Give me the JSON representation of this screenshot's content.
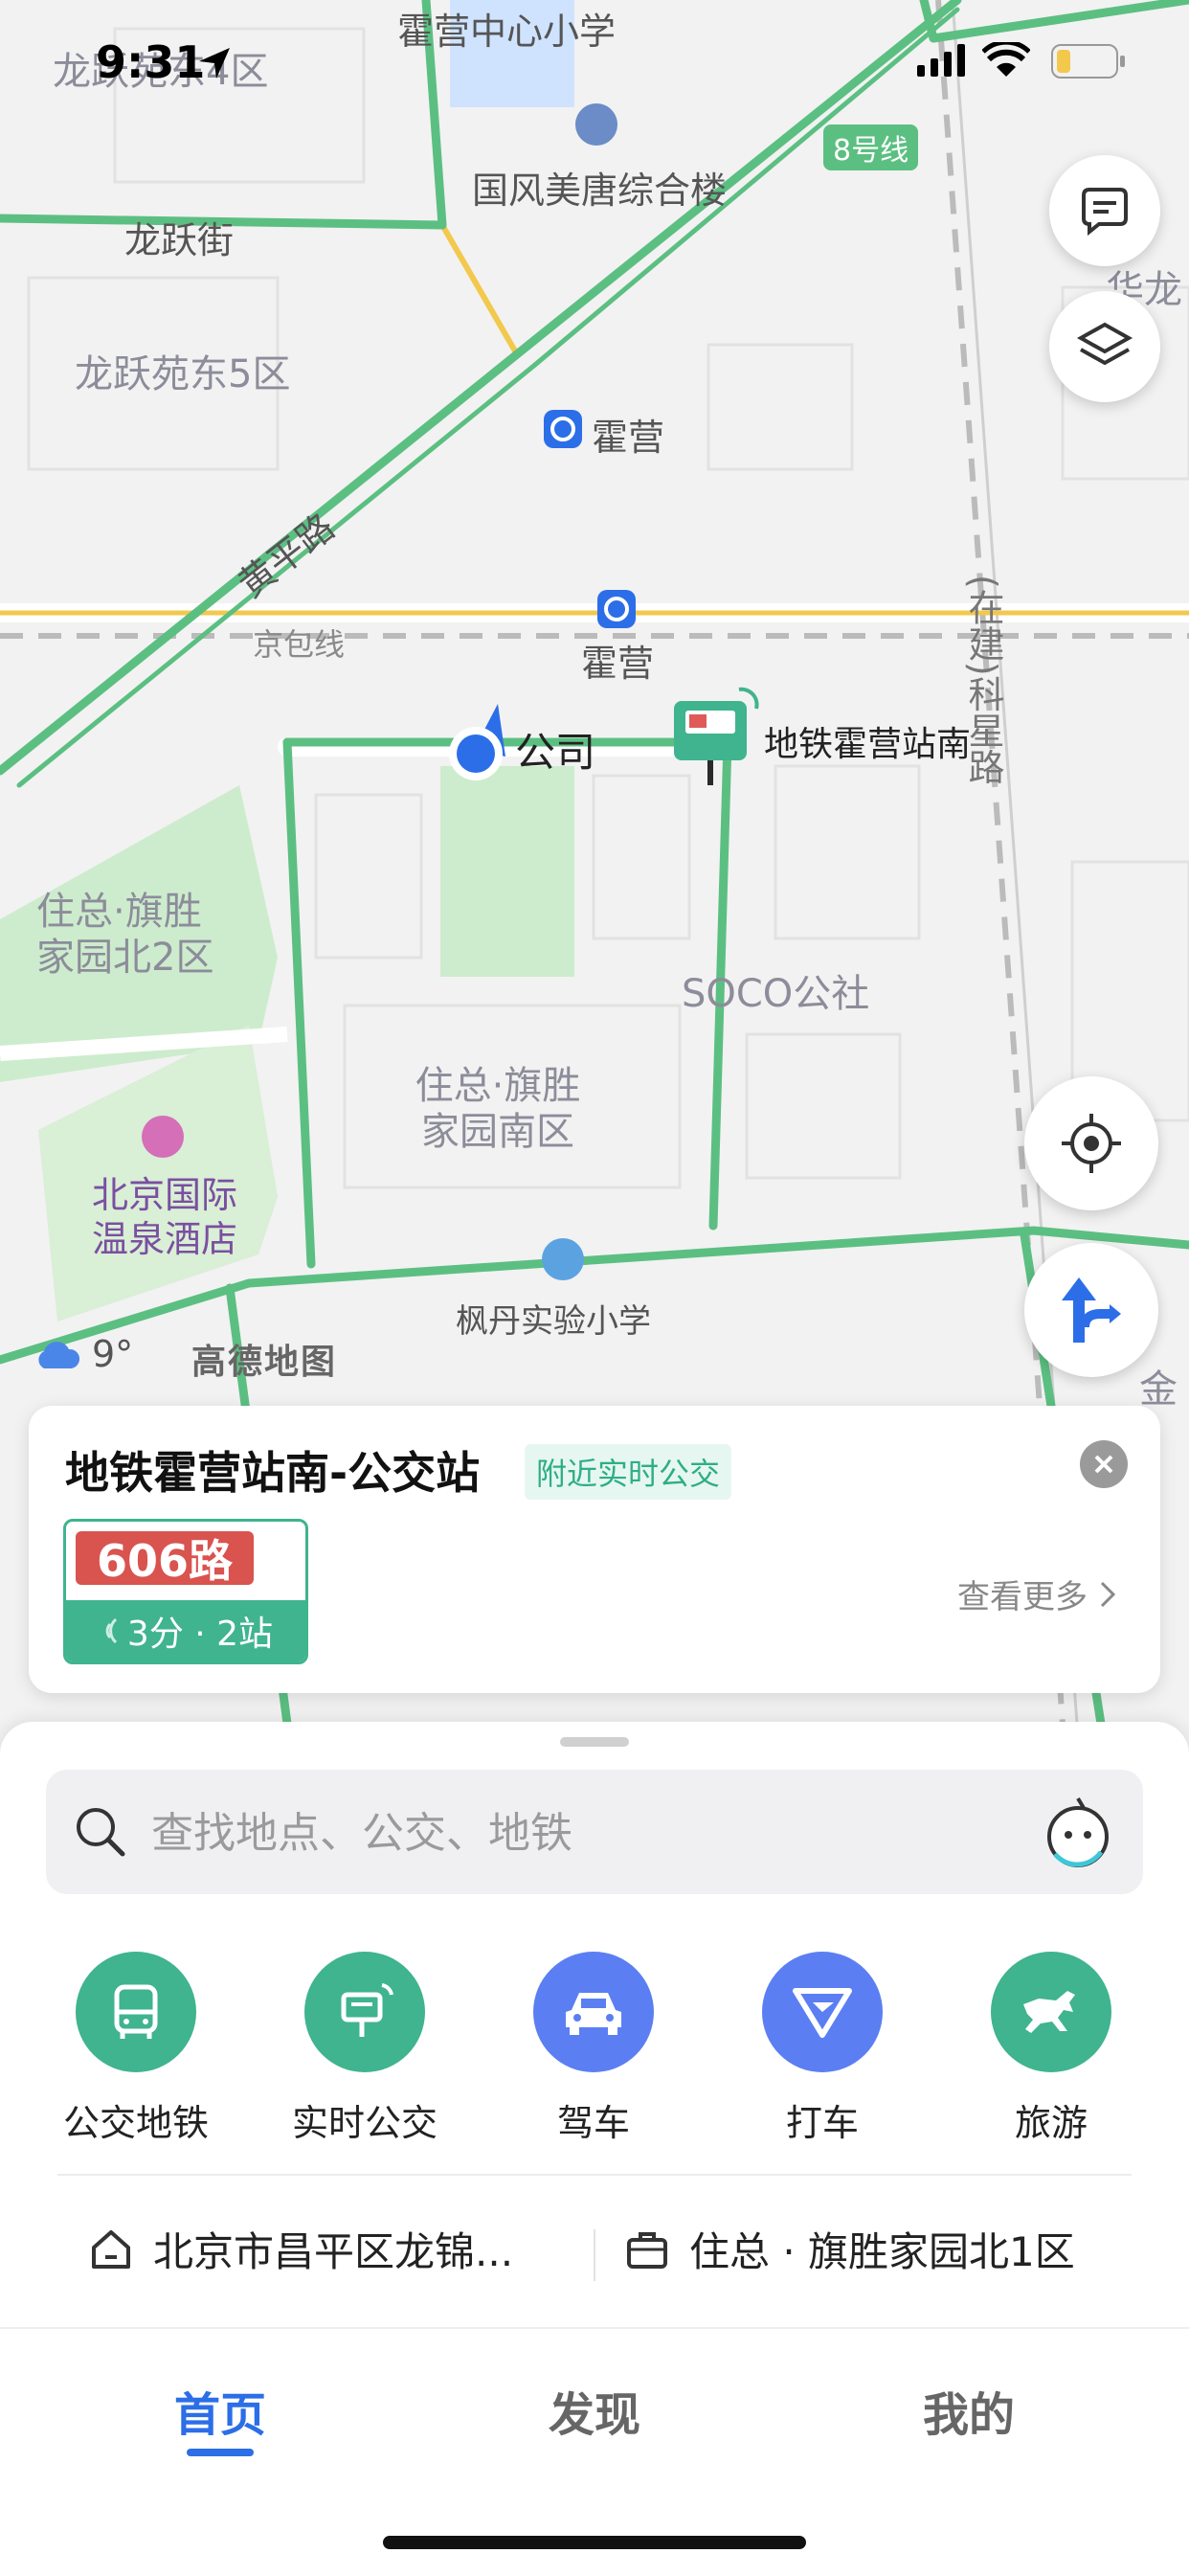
{
  "status_bar": {
    "time": "9:31",
    "battery_color": "#f2c94c"
  },
  "map": {
    "labels": {
      "huoying_school": "霍营中心小学",
      "longyue_4": "龙跃苑东4区",
      "guofeng_building": "国风美唐综合楼",
      "line8": "8号线",
      "longyue_street": "龙跃街",
      "hualong": "华龙",
      "longyue_5": "龙跃苑东5区",
      "huoying_subway": "霍营",
      "huangping_road": "黄平路",
      "huoying_rail": "霍营",
      "jingbao_line": "京包线",
      "kexing_road": "(在建)科星路",
      "company": "公司",
      "bus_stop_label": "地铁霍营站南",
      "qisheng_north2": "住总·旗胜家园北2区",
      "soco": "SOCO公社",
      "qisheng_south": "住总·旗胜家园南区",
      "hotel": "北京国际温泉酒店",
      "fengdan_school": "枫丹实验小学",
      "jin": "金"
    },
    "weather": {
      "temperature": "9°",
      "icon": "cloud-icon"
    },
    "logo": "高德地图",
    "road_color": "#5cbf82",
    "water_color": "#cfe3ff",
    "green_color": "#cdeccd"
  },
  "bus_card": {
    "title": "地铁霍营站南-公交站",
    "tag": "附近实时公交",
    "route_name": "606路",
    "eta": "3分 · 2站",
    "more": "查看更多"
  },
  "search": {
    "placeholder": "查找地点、公交、地铁"
  },
  "quick_actions": [
    {
      "label": "公交地铁",
      "color": "#3fb48e",
      "icon": "bus-icon"
    },
    {
      "label": "实时公交",
      "color": "#3fb48e",
      "icon": "realtime-bus-icon"
    },
    {
      "label": "驾车",
      "color": "#5b7ff2",
      "icon": "car-icon"
    },
    {
      "label": "打车",
      "color": "#5b7ff2",
      "icon": "taxi-icon"
    },
    {
      "label": "旅游",
      "color": "#3fb48e",
      "icon": "horse-icon"
    }
  ],
  "shortcuts": {
    "home": "北京市昌平区龙锦...",
    "work": "住总 · 旗胜家园北1区"
  },
  "tabs": [
    "首页",
    "发现",
    "我的"
  ]
}
